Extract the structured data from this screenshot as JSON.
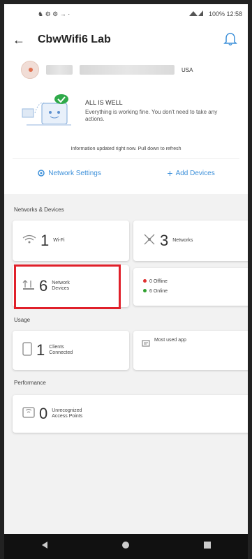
{
  "statusbar": {
    "left": "♞ ⚙ ⚙ → ·",
    "right": "100% 12:58"
  },
  "header": {
    "title": "CbwWifi6 Lab"
  },
  "location": {
    "suffix": "USA"
  },
  "status": {
    "heading": "ALL IS WELL",
    "message": "Everything is working fine. You don't need to take any actions."
  },
  "info": "Information updated right now. Pull down to refresh",
  "actions": {
    "settings": "Network Settings",
    "add": "Add Devices"
  },
  "sections": {
    "networks": "Networks & Devices",
    "usage": "Usage",
    "performance": "Performance"
  },
  "cards": {
    "wifi": {
      "count": "1",
      "label": "Wi-Fi"
    },
    "networks": {
      "count": "3",
      "label": "Networks"
    },
    "devices": {
      "count": "6",
      "label_line1": "Network",
      "label_line2": "Devices"
    },
    "offline": "0 Offline",
    "online": "6 Online",
    "clients": {
      "count": "1",
      "label_line1": "Clients",
      "label_line2": "Connected"
    },
    "most_used": "Most used app",
    "aps": {
      "count": "0",
      "label_line1": "Unrecognized",
      "label_line2": "Access Points"
    }
  },
  "colors": {
    "accent": "#3b8fd9",
    "highlight": "#e0202a",
    "offline": "#e03030",
    "online": "#30a030"
  }
}
